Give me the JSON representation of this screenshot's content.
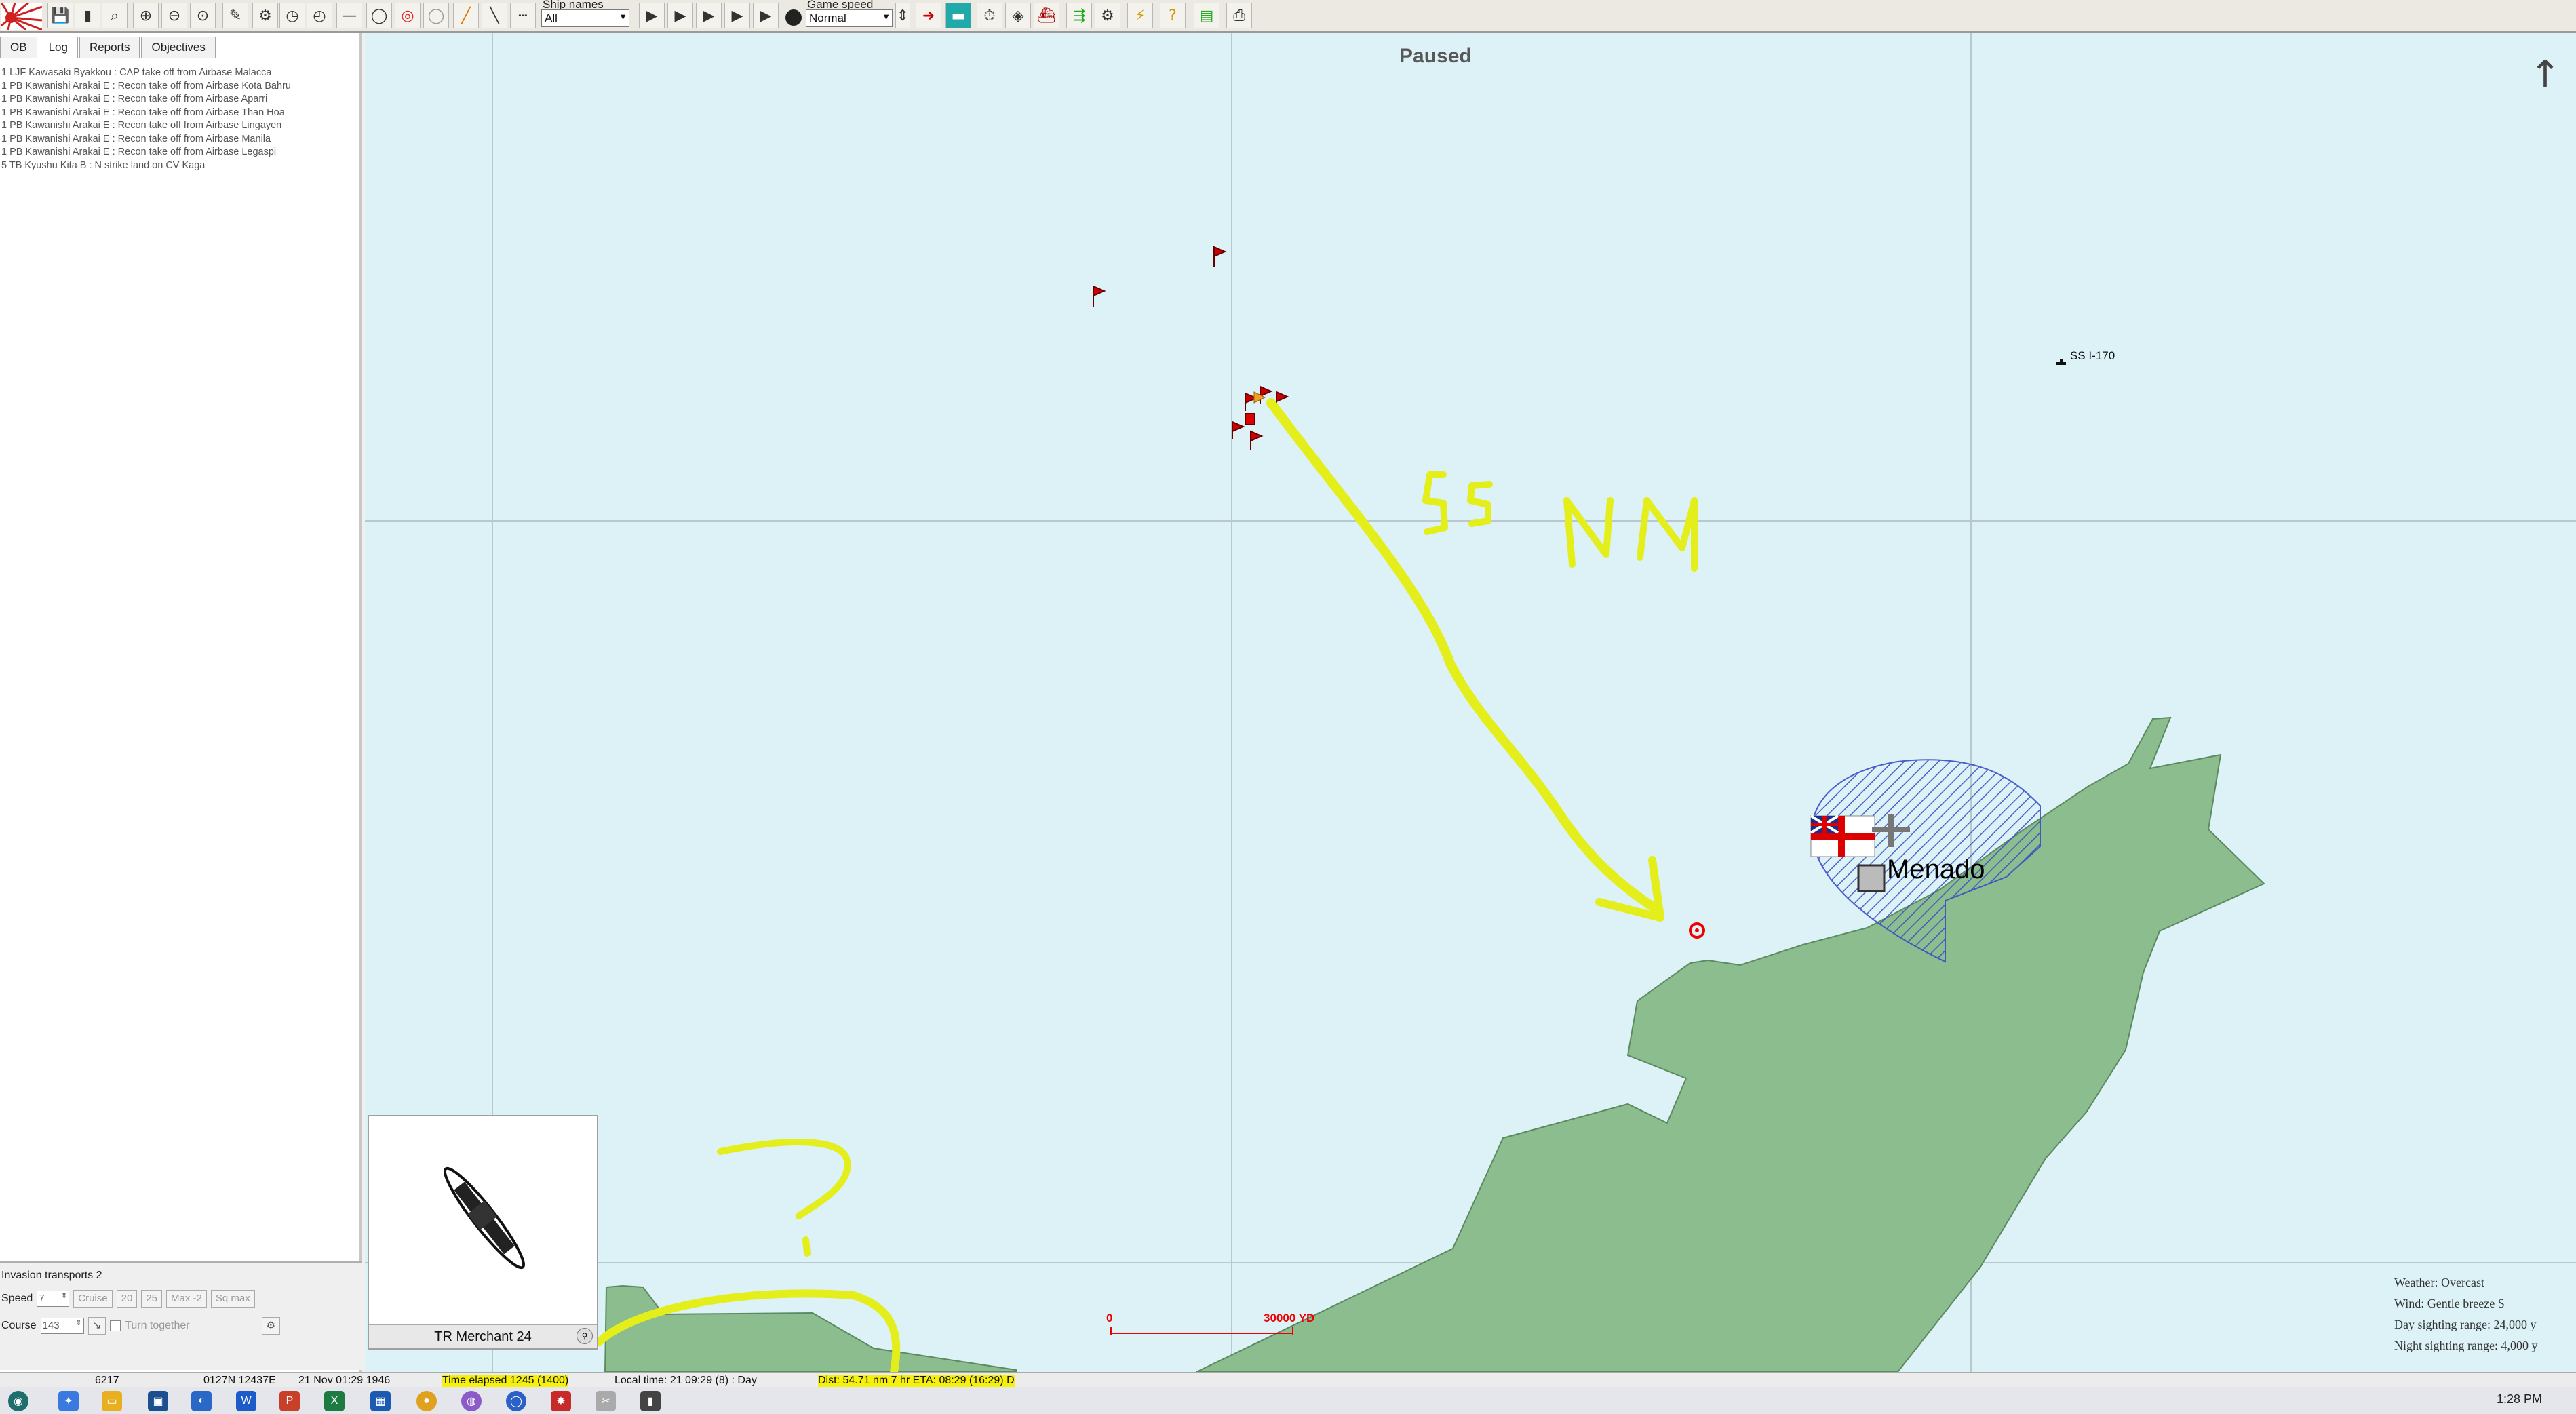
{
  "toolbar": {
    "ship_names_label": "Ship names",
    "ship_names_value": "All",
    "game_speed_label": "Game speed",
    "game_speed_value": "Normal"
  },
  "left_panel": {
    "tabs": [
      "OB",
      "Log",
      "Reports",
      "Objectives"
    ],
    "active_tab": "Log",
    "log_entries": [
      "1 LJF Kawasaki Byakkou : CAP take off from Airbase Malacca",
      "1 PB Kawanishi Arakai E : Recon take off from Airbase Kota Bahru",
      "1 PB Kawanishi Arakai E : Recon take off from Airbase Aparri",
      "1 PB Kawanishi Arakai E : Recon take off from Airbase Than Hoa",
      "1 PB Kawanishi Arakai E : Recon take off from Airbase Lingayen",
      "1 PB Kawanishi Arakai E : Recon take off from Airbase Manila",
      "1 PB Kawanishi Arakai E : Recon take off from Airbase Legaspi",
      "5 TB Kyushu Kita B : N strike land on CV Kaga"
    ],
    "task_force": {
      "name": "Invasion transports 2",
      "speed_label": "Speed",
      "speed_value": "7",
      "buttons": [
        "Cruise",
        "20",
        "25",
        "Max -2",
        "Sq max"
      ],
      "course_label": "Course",
      "course_value": "143",
      "turn_together_label": "Turn together"
    }
  },
  "map": {
    "status": "Paused",
    "north_arrow": "↑",
    "ship_label": "SS I-170",
    "place_name": "Menado",
    "scale_start": "0",
    "scale_end": "30000 YD",
    "annotation_distance": "55 NM",
    "annotation_question": "?",
    "weather": [
      "Weather: Overcast",
      "Wind: Gentle breeze  S",
      "Day sighting range: 24,000 y",
      "Night sighting range: 4,000 y"
    ],
    "preview_ship_name": "TR Merchant 24"
  },
  "statusbar": {
    "id": "6217",
    "coords": "0127N 12437E",
    "date": "21 Nov 01:29 1946",
    "time_elapsed": "Time elapsed 1245 (1400)",
    "local_time": "Local time: 21 09:29 (8) : Day",
    "dist": "Dist: 54.71 nm 7 hr ETA: 08:29 (16:29) D"
  },
  "taskbar": {
    "clock": "1:28 PM"
  },
  "colors": {
    "sea": "#dcf2f7",
    "land": "#8bbd8f",
    "annotation": "#e3ee1a",
    "flag": "#cc0000"
  }
}
